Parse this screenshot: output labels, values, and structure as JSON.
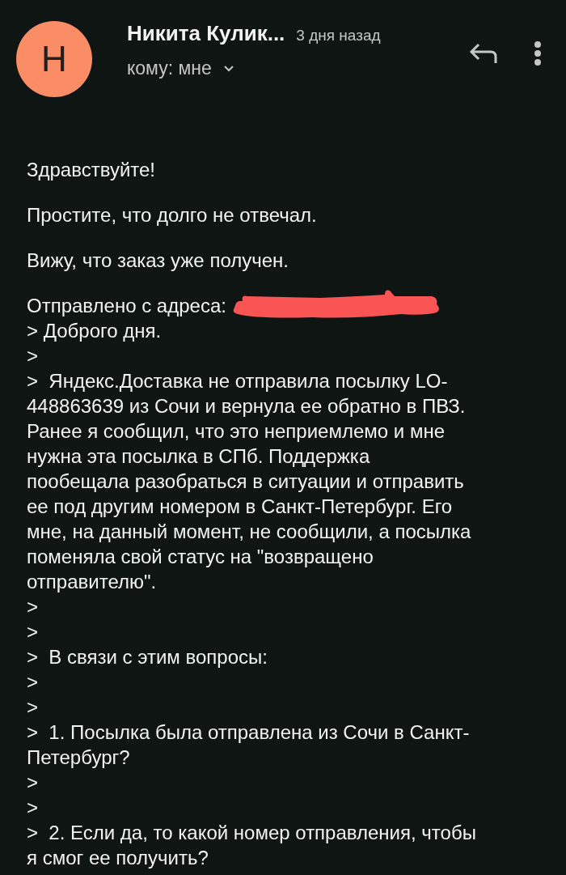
{
  "header": {
    "avatar_letter": "Н",
    "sender": "Никита Кулик...",
    "time": "3 дня назад",
    "recipient": "кому: мне"
  },
  "body": {
    "paragraphs": [
      "Здравствуйте!",
      "Простите, что долго не отвечал.",
      "Вижу, что заказ уже получен."
    ],
    "sent_from": "Отправлено с адреса:",
    "quoted_lines": [
      "> Доброго дня.",
      ">",
      ">  Яндекс.Доставка не отправила посылку LO-",
      "448863639 из Сочи и вернула ее обратно в ПВЗ.",
      "Ранее я сообщил, что это неприемлемо и мне",
      "нужна эта посылка в СПб. Поддержка",
      "пообещала разобраться в ситуации и отправить",
      "ее под другим номером в Санкт-Петербург. Его",
      "мне, на данный момент, не сообщили, а посылка",
      "поменяла свой статус на \"возвращено",
      "отправителю\".",
      ">",
      ">",
      ">  В связи с этим вопросы:",
      ">",
      ">",
      ">  1. Посылка была отправлена из Сочи в Санкт-",
      "Петербург?",
      ">",
      ">",
      ">  2. Если да, то какой номер отправления, чтобы",
      "я смог ее получить?"
    ]
  }
}
